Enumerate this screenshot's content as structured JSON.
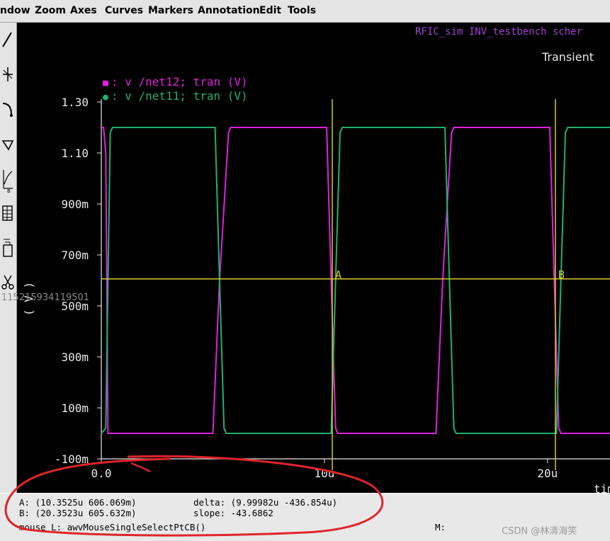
{
  "menu": [
    "ndow",
    "Zoom",
    "Axes",
    "Curves",
    "Markers",
    "Annotation",
    "Edit",
    "Tools"
  ],
  "toolbar_icons": [
    "line-tool-icon",
    "cross-marker-icon",
    "curve-tool-icon",
    "shape-tool-icon",
    "axis-scale-icon",
    "table-icon",
    "copy-icon",
    "scissors-icon"
  ],
  "header": {
    "title": "RFIC_sim INV_testbench scher",
    "analysis": "Transient"
  },
  "legend": [
    {
      "marker": "■",
      "text": ": v /net12; tran (V)",
      "color": "#e020e0"
    },
    {
      "marker": "●",
      "text": ": v /net11; tran (V)",
      "color": "#20b070"
    }
  ],
  "y_axis_title": "( V )",
  "x_axis_title": "tim",
  "markers": [
    {
      "label": "A",
      "x_us": 10.3525
    },
    {
      "label": "B",
      "x_us": 20.3523
    }
  ],
  "readout": {
    "a": "A: (10.3525u 606.069m)",
    "b": "B: (20.3523u 605.632m)",
    "delta": "delta: (9.99982u -436.854u)",
    "slope": "slope: -43.6862"
  },
  "status_left": "mouse L: awvMouseSingleSelectPtCB()",
  "status_right": "M:",
  "watermark": "CSDN @林清海笑",
  "overlay_id": "115215934119501",
  "colors": {
    "net12": "#e020e0",
    "net11": "#20b070",
    "marker": "#d8c830",
    "axis": "#e8e8e8",
    "header": "#a040d0",
    "annotation": "#e0242a"
  },
  "chart_data": {
    "type": "line",
    "xlabel": "tim",
    "ylabel": "( V )",
    "xlim": [
      0,
      22.8
    ],
    "ylim": [
      -0.1,
      1.3
    ],
    "x_ticks": [
      {
        "value": 0,
        "label": "0.0"
      },
      {
        "value": 10,
        "label": "10u"
      },
      {
        "value": 20,
        "label": "20u"
      }
    ],
    "y_ticks": [
      {
        "value": 1.3,
        "label": "1.30"
      },
      {
        "value": 1.1,
        "label": "1.10"
      },
      {
        "value": 0.9,
        "label": "900m"
      },
      {
        "value": 0.7,
        "label": "700m"
      },
      {
        "value": 0.5,
        "label": "500m"
      },
      {
        "value": 0.3,
        "label": "300m"
      },
      {
        "value": 0.1,
        "label": "100m"
      },
      {
        "value": -0.1,
        "label": "-100m"
      }
    ],
    "series": [
      {
        "name": "v /net12; tran (V)",
        "x": [
          0,
          0.1,
          0.2,
          0.3,
          5.0,
          5.3,
          5.7,
          5.8,
          10.1,
          10.3,
          10.5,
          10.6,
          15.0,
          15.3,
          15.7,
          15.8,
          20.1,
          20.3,
          20.5,
          20.6,
          22.8
        ],
        "values": [
          1.2,
          1.2,
          1.1,
          0.0,
          0.0,
          0.6,
          1.18,
          1.2,
          1.2,
          0.6,
          0.02,
          0.0,
          0.0,
          0.6,
          1.18,
          1.2,
          1.2,
          0.6,
          0.02,
          0.0,
          0.0
        ]
      },
      {
        "name": "v /net11; tran (V)",
        "x": [
          0,
          0.2,
          0.4,
          0.5,
          5.1,
          5.3,
          5.5,
          5.6,
          10.3,
          10.5,
          10.7,
          10.8,
          15.4,
          15.6,
          15.8,
          15.9,
          20.4,
          20.6,
          20.8,
          20.9,
          22.8
        ],
        "values": [
          0.0,
          0.02,
          1.18,
          1.2,
          1.2,
          0.6,
          0.02,
          0.0,
          0.0,
          0.6,
          1.18,
          1.2,
          1.2,
          0.6,
          0.02,
          0.0,
          0.0,
          0.6,
          1.18,
          1.2,
          1.2
        ]
      }
    ],
    "marker_y": 0.606,
    "legend_position": "top-left"
  }
}
